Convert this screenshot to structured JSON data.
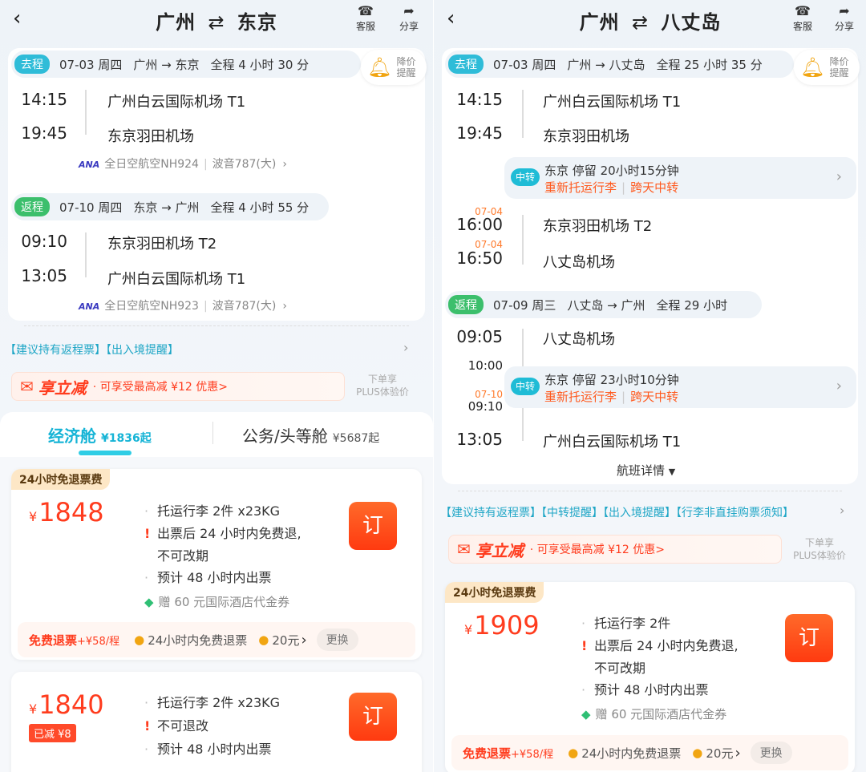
{
  "left": {
    "title_from": "广州",
    "title_to": "东京",
    "route_arrow": "⇄",
    "back_icon": "chevron-left",
    "service_label": "客服",
    "share_label": "分享",
    "alert": {
      "line1": "降价",
      "line2": "提醒"
    },
    "outbound": {
      "tag": "去程",
      "date": "07-03 周四",
      "route": "广州 → 东京",
      "duration": "全程 4 小时 30 分",
      "dep_time": "14:15",
      "dep_airport": "广州白云国际机场 T1",
      "arr_time": "19:45",
      "arr_airport": "东京羽田机场",
      "airline": "全日空航空NH924",
      "aircraft": "波音787(大)"
    },
    "return": {
      "tag": "返程",
      "date": "07-10 周四",
      "route": "东京 → 广州",
      "duration": "全程 4 小时 55 分",
      "dep_time": "09:10",
      "dep_airport": "东京羽田机场 T2",
      "arr_time": "13:05",
      "arr_airport": "广州白云国际机场 T1",
      "airline": "全日空航空NH923",
      "aircraft": "波音787(大)"
    },
    "notice": "【建议持有返程票】【出入境提醒】",
    "promo": {
      "title": "享立减",
      "text": "· 可享受最高减 ¥12 优惠>"
    },
    "plus": {
      "line1": "下单享",
      "line2": "PLUS体验价"
    },
    "tabs": {
      "economy": "经济舱",
      "economy_price": "¥1836起",
      "business": "公务/头等舱",
      "business_price": "¥5687起"
    },
    "fare1": {
      "badge": "24小时免退票费",
      "currency": "¥",
      "price": "1848",
      "item1": "托运行李 2件 x23KG",
      "item2": "出票后 24 小时内免费退,",
      "item2b": "不可改期",
      "item3": "预计 48 小时内出票",
      "gift": "赠 60 元国际酒店代金券",
      "book": "订",
      "strip_refund": "免费退票",
      "strip_refund_price": "+¥58/程",
      "strip_item1": "24小时内免费退票",
      "strip_item2": "20元",
      "strip_change": "更换"
    },
    "fare2": {
      "currency": "¥",
      "price": "1840",
      "reduced": "已减 ¥8",
      "item1": "托运行李 2件 x23KG",
      "item2": "不可退改",
      "item3": "预计 48 小时内出票",
      "book": "订"
    }
  },
  "right": {
    "title_from": "广州",
    "title_to": "八丈岛",
    "route_arrow": "⇄",
    "service_label": "客服",
    "share_label": "分享",
    "alert": {
      "line1": "降价",
      "line2": "提醒"
    },
    "outbound": {
      "tag": "去程",
      "date": "07-03 周四",
      "route": "广州 → 八丈岛",
      "duration": "全程 25 小时 35 分",
      "dep_time": "14:15",
      "dep_airport": "广州白云国际机场 T1",
      "arr_time": "19:45",
      "arr_airport": "东京羽田机场",
      "transfer_tag": "中转",
      "transfer_city": "东京",
      "transfer_stay": "停留 20小时15分钟",
      "transfer_note1": "重新托运行李",
      "transfer_note2": "跨天中转",
      "leg2_date": "07-04",
      "leg2_dep_time": "16:00",
      "leg2_dep_airport": "东京羽田机场 T2",
      "leg2_arr_date": "07-04",
      "leg2_arr_time": "16:50",
      "leg2_arr_airport": "八丈岛机场"
    },
    "return": {
      "tag": "返程",
      "date": "07-09 周三",
      "route": "八丈岛 → 广州",
      "duration": "全程 29 小时",
      "dep_time": "09:05",
      "dep_airport": "八丈岛机场",
      "arr_time1": "10:00",
      "transfer_tag": "中转",
      "transfer_city": "东京",
      "transfer_stay": "停留 23小时10分钟",
      "transfer_note1": "重新托运行李",
      "transfer_note2": "跨天中转",
      "leg2_date": "07-10",
      "leg2_dep_time": "09:10",
      "final_time": "13:05",
      "final_airport": "广州白云国际机场 T1"
    },
    "details": "航班详情",
    "notice": "【建议持有返程票】【中转提醒】【出入境提醒】【行李非直挂购票须知】",
    "promo": {
      "title": "享立减",
      "text": "· 可享受最高减 ¥12 优惠>"
    },
    "plus": {
      "line1": "下单享",
      "line2": "PLUS体验价"
    },
    "fare1": {
      "badge": "24小时免退票费",
      "currency": "¥",
      "price": "1909",
      "item1": "托运行李 2件",
      "item2": "出票后 24 小时内免费退,",
      "item2b": "不可改期",
      "item3": "预计 48 小时内出票",
      "gift": "赠 60 元国际酒店代金券",
      "book": "订",
      "strip_refund": "免费退票",
      "strip_refund_price": "+¥58/程",
      "strip_item1": "24小时内免费退票",
      "strip_item2": "20元",
      "strip_change": "更换"
    }
  }
}
